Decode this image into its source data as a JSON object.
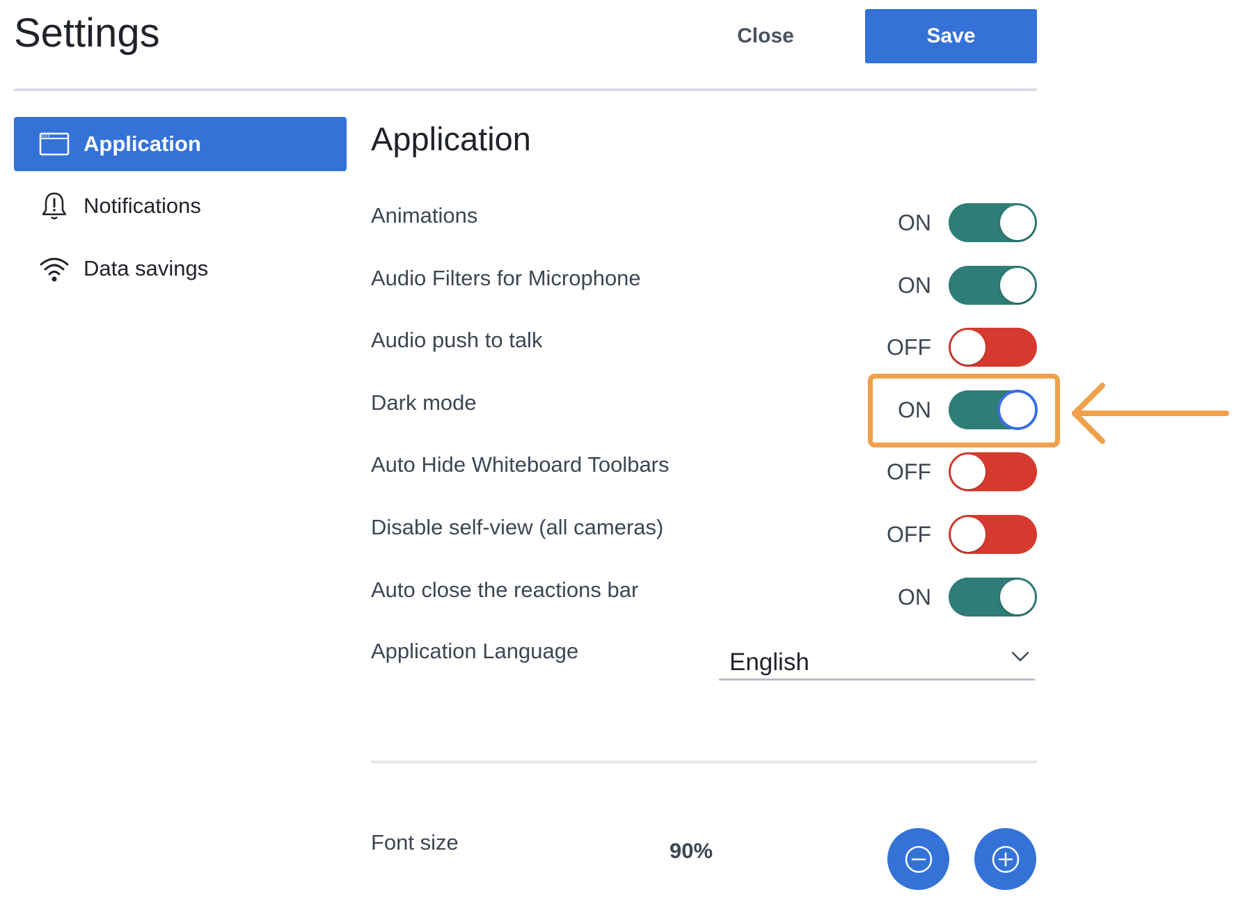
{
  "header": {
    "title": "Settings",
    "close_label": "Close",
    "save_label": "Save"
  },
  "sidebar": {
    "items": [
      {
        "label": "Application",
        "icon": "window-icon",
        "active": true
      },
      {
        "label": "Notifications",
        "icon": "bell-alert-icon",
        "active": false
      },
      {
        "label": "Data savings",
        "icon": "wifi-icon",
        "active": false
      }
    ]
  },
  "main": {
    "section_title": "Application",
    "settings": [
      {
        "label": "Animations",
        "state": "ON"
      },
      {
        "label": "Audio Filters for Microphone",
        "state": "ON"
      },
      {
        "label": "Audio push to talk",
        "state": "OFF"
      },
      {
        "label": "Dark mode",
        "state": "ON"
      },
      {
        "label": "Auto Hide Whiteboard Toolbars",
        "state": "OFF"
      },
      {
        "label": "Disable self-view (all cameras)",
        "state": "OFF"
      },
      {
        "label": "Auto close the reactions bar",
        "state": "ON"
      }
    ],
    "language": {
      "label": "Application Language",
      "value": "English"
    },
    "font_size": {
      "label": "Font size",
      "value": "90%"
    }
  },
  "colors": {
    "accent": "#3472d8",
    "toggle_on": "#2e7d76",
    "toggle_off": "#d63a2f",
    "annotation": "#f0a04b"
  }
}
